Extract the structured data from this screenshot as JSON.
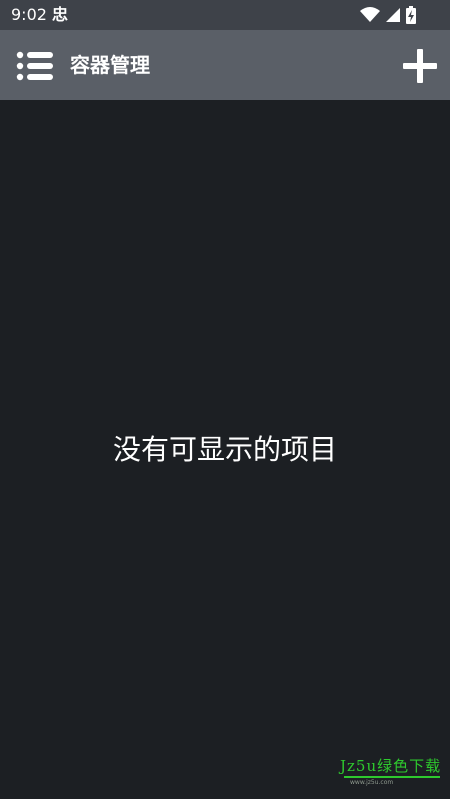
{
  "status_bar": {
    "time": "9:02",
    "notification_glyph": "忠",
    "icons": [
      "wifi-icon",
      "cell-signal-icon",
      "battery-charging-icon"
    ]
  },
  "app_bar": {
    "title": "容器管理",
    "menu_icon": "list-menu-icon",
    "add_icon": "plus-icon"
  },
  "content": {
    "empty_message": "没有可显示的项目"
  },
  "watermark": {
    "text": "Jz5u绿色下载",
    "subtext": "www.jz5u.com"
  },
  "colors": {
    "status_bar_bg": "#3e4249",
    "app_bar_bg": "#5a5f67",
    "content_bg": "#1c1f23",
    "text": "#ffffff",
    "watermark": "#2ec92e"
  }
}
